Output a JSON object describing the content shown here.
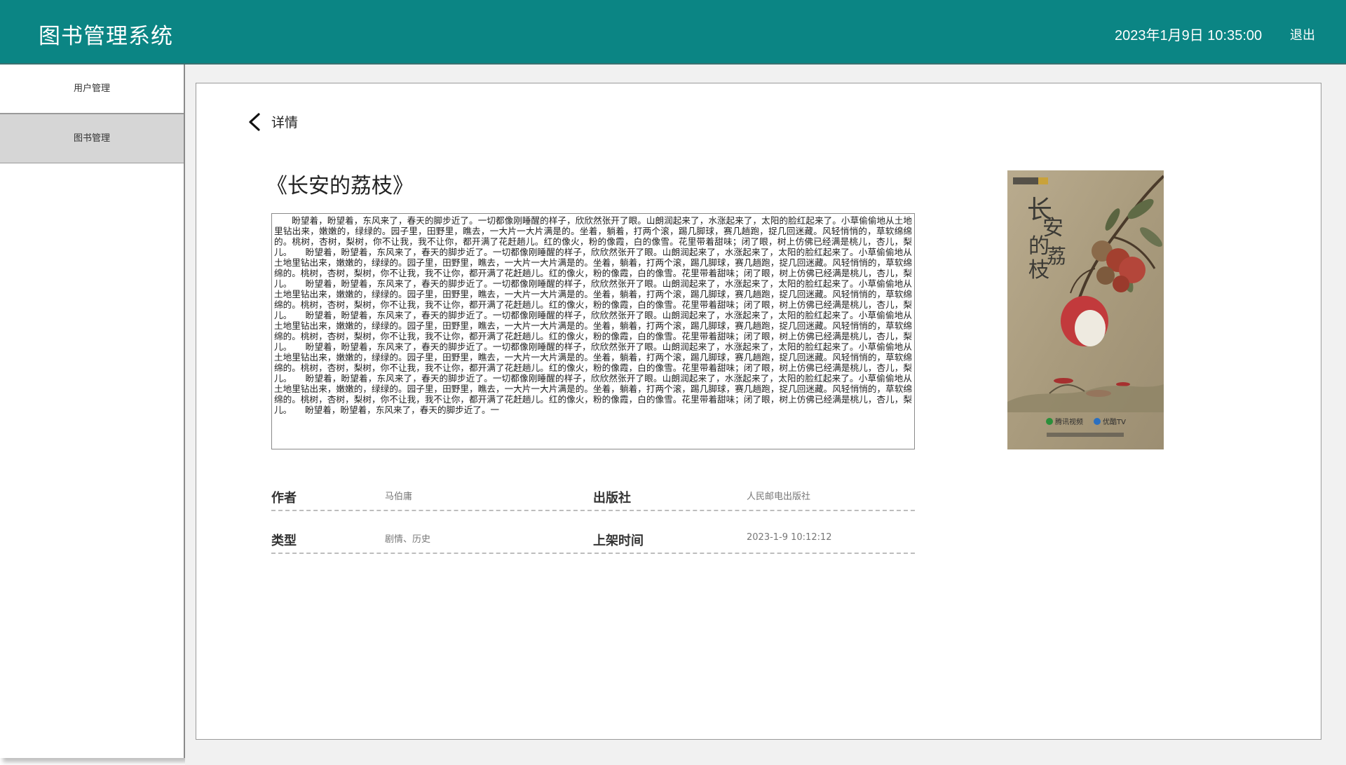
{
  "header": {
    "app_title": "图书管理系统",
    "datetime": "2023年1月9日 10:35:00",
    "logout_label": "退出"
  },
  "sidebar": {
    "items": [
      {
        "label": "用户管理"
      },
      {
        "label": "图书管理"
      }
    ]
  },
  "detail": {
    "back_label": "详情",
    "book_title": "《长安的荔枝》",
    "description": "　　盼望着，盼望着，东风来了，春天的脚步近了。一切都像刚睡醒的样子，欣欣然张开了眼。山朗润起来了，水涨起来了，太阳的脸红起来了。小草偷偷地从土地里钻出来，嫩嫩的，绿绿的。园子里，田野里，瞧去，一大片一大片满是的。坐着，躺着，打两个滚，踢几脚球，赛几趟跑，捉几回迷藏。风轻悄悄的，草软绵绵的。桃树，杏树，梨树，你不让我，我不让你，都开满了花赶趟儿。红的像火，粉的像霞，白的像雪。花里带着甜味；闭了眼，树上仿佛已经满是桃儿，杏儿，梨儿。　　盼望着，盼望着，东风来了，春天的脚步近了。一切都像刚睡醒的样子，欣欣然张开了眼。山朗润起来了，水涨起来了，太阳的脸红起来了。小草偷偷地从土地里钻出来，嫩嫩的，绿绿的。园子里，田野里，瞧去，一大片一大片满是的。坐着，躺着，打两个滚，踢几脚球，赛几趟跑，捉几回迷藏。风轻悄悄的，草软绵绵的。桃树，杏树，梨树，你不让我，我不让你，都开满了花赶趟儿。红的像火，粉的像霞，白的像雪。花里带着甜味；闭了眼，树上仿佛已经满是桃儿，杏儿，梨儿。　　盼望着，盼望着，东风来了，春天的脚步近了。一切都像刚睡醒的样子，欣欣然张开了眼。山朗润起来了，水涨起来了，太阳的脸红起来了。小草偷偷地从土地里钻出来，嫩嫩的，绿绿的。园子里，田野里，瞧去，一大片一大片满是的。坐着，躺着，打两个滚，踢几脚球，赛几趟跑，捉几回迷藏。风轻悄悄的，草软绵绵的。桃树，杏树，梨树，你不让我，我不让你，都开满了花赶趟儿。红的像火，粉的像霞，白的像雪。花里带着甜味；闭了眼，树上仿佛已经满是桃儿，杏儿，梨儿。　　盼望着，盼望着，东风来了，春天的脚步近了。一切都像刚睡醒的样子，欣欣然张开了眼。山朗润起来了，水涨起来了，太阳的脸红起来了。小草偷偷地从土地里钻出来，嫩嫩的，绿绿的。园子里，田野里，瞧去，一大片一大片满是的。坐着，躺着，打两个滚，踢几脚球，赛几趟跑，捉几回迷藏。风轻悄悄的，草软绵绵的。桃树，杏树，梨树，你不让我，我不让你，都开满了花赶趟儿。红的像火，粉的像霞，白的像雪。花里带着甜味；闭了眼，树上仿佛已经满是桃儿，杏儿，梨儿。　　盼望着，盼望着，东风来了，春天的脚步近了。一切都像刚睡醒的样子，欣欣然张开了眼。山朗润起来了，水涨起来了，太阳的脸红起来了。小草偷偷地从土地里钻出来，嫩嫩的，绿绿的。园子里，田野里，瞧去，一大片一大片满是的。坐着，躺着，打两个滚，踢几脚球，赛几趟跑，捉几回迷藏。风轻悄悄的，草软绵绵的。桃树，杏树，梨树，你不让我，我不让你，都开满了花赶趟儿。红的像火，粉的像霞，白的像雪。花里带着甜味；闭了眼，树上仿佛已经满是桃儿，杏儿，梨儿。　　盼望着，盼望着，东风来了，春天的脚步近了。一切都像刚睡醒的样子，欣欣然张开了眼。山朗润起来了，水涨起来了，太阳的脸红起来了。小草偷偷地从土地里钻出来，嫩嫩的，绿绿的。园子里，田野里，瞧去，一大片一大片满是的。坐着，躺着，打两个滚，踢几脚球，赛几趟跑，捉几回迷藏。风轻悄悄的，草软绵绵的。桃树，杏树，梨树，你不让我，我不让你，都开满了花赶趟儿。红的像火，粉的像霞，白的像雪。花里带着甜味；闭了眼，树上仿佛已经满是桃儿，杏儿，梨儿。　　盼望着，盼望着，东风来了，春天的脚步近了。一",
    "poster": {
      "title_glyphs": [
        "长",
        "安",
        "的",
        "荔",
        "枝"
      ],
      "platform_1": "腾讯视频",
      "platform_2": "优酷TV"
    },
    "fields": {
      "author_label": "作者",
      "author_value": "马伯庸",
      "publisher_label": "出版社",
      "publisher_value": "人民邮电出版社",
      "genre_label": "类型",
      "genre_value": "剧情、历史",
      "shelf_time_label": "上架时间",
      "shelf_time_value": "2023-1-9 10:12:12"
    }
  },
  "colors": {
    "header_bg": "#0b8584",
    "sidebar_active_bg": "#d6d6d6",
    "content_bg": "#f1f1f1"
  }
}
